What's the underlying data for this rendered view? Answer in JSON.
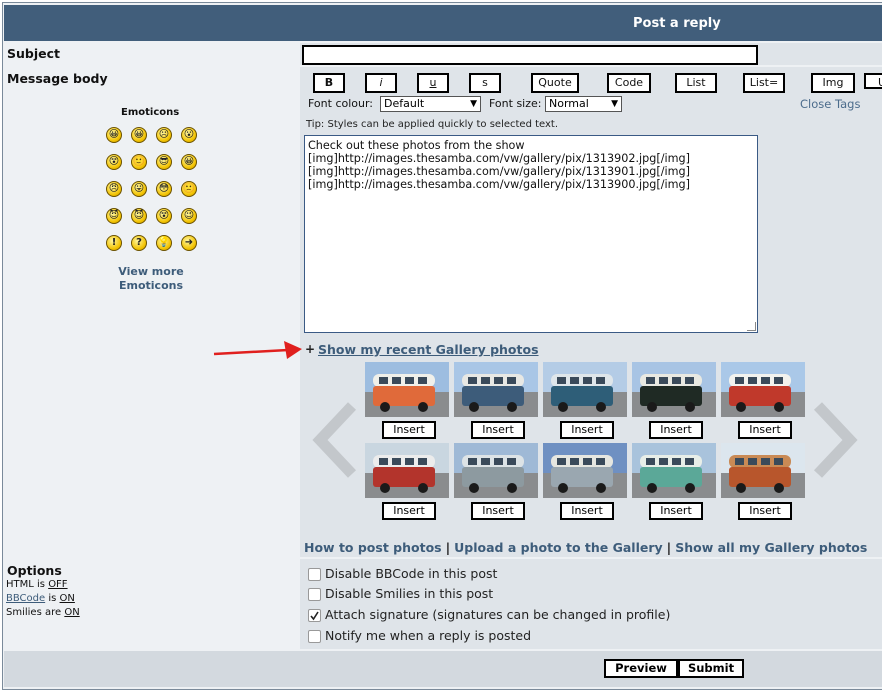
{
  "header": {
    "title": "Post a reply"
  },
  "subject": {
    "label": "Subject",
    "value": ""
  },
  "message": {
    "label": "Message body"
  },
  "emoticons": {
    "title": "Emoticons",
    "view_more_line1": "View more",
    "view_more_line2": "Emoticons",
    "rows": [
      [
        "😀",
        "😀",
        "☹",
        "😮"
      ],
      [
        "😵",
        "🙂",
        "😎",
        "😀"
      ],
      [
        "😠",
        "😛",
        "😳",
        "🙁"
      ],
      [
        "😈",
        "😈",
        "😵",
        "😉"
      ],
      [
        "!",
        "?",
        "💡",
        "➜"
      ]
    ]
  },
  "toolbar": {
    "b": "B",
    "i": "i",
    "u": "u",
    "s": "s",
    "quote": "Quote",
    "code": "Code",
    "list": "List",
    "list_eq": "List=",
    "img": "Img",
    "url": "U"
  },
  "font": {
    "colour_label": "Font colour:",
    "colour_value": "Default",
    "size_label": "Font size:",
    "size_value": "Normal",
    "close_tags": "Close Tags"
  },
  "tip": "Tip: Styles can be applied quickly to selected text.",
  "body_text": {
    "line1": "Check out these photos from the show",
    "line2": "[img]http://images.thesamba.com/vw/gallery/pix/1313902.jpg[/img]",
    "line3": "[img]http://images.thesamba.com/vw/gallery/pix/1313901.jpg[/img]",
    "line4": "[img]http://images.thesamba.com/vw/gallery/pix/1313900.jpg[/img]"
  },
  "gallery": {
    "toggle": "+",
    "show_recent": "Show my recent Gallery photos",
    "insert_label": "Insert",
    "thumbs_row1": [
      {
        "body": "#e06a3a",
        "top": "#f0f0ea",
        "sky": "#9dbde0"
      },
      {
        "body": "#3d5c7a",
        "top": "#e8e8e4",
        "sky": "#a9c6e6"
      },
      {
        "body": "#2e5e78",
        "top": "#dfe6ea",
        "sky": "#b4cce6"
      },
      {
        "body": "#1f2a24",
        "top": "#e9e9e2",
        "sky": "#a8c4e4"
      },
      {
        "body": "#c0392b",
        "top": "#f2f2ee",
        "sky": "#aac8e8"
      }
    ],
    "thumbs_row2": [
      {
        "body": "#b3342c",
        "top": "#ececec",
        "sky": "#c9d6e0"
      },
      {
        "body": "#8d9aa0",
        "top": "#dde3e6",
        "sky": "#9fb9d6"
      },
      {
        "body": "#9aa7b0",
        "top": "#e6e6e0",
        "sky": "#6f90c2"
      },
      {
        "body": "#5ba898",
        "top": "#e8eee8",
        "sky": "#a9c3dc"
      },
      {
        "body": "#b8562c",
        "top": "#c98a55",
        "sky": "#dce6ee"
      }
    ]
  },
  "links": {
    "how_to": "How to post photos",
    "upload": "Upload a photo to the Gallery",
    "show_all": "Show all my Gallery photos",
    "separator": "|"
  },
  "options": {
    "title": "Options",
    "html_prefix": "HTML is",
    "html_state": "OFF",
    "bbcode_label": "BBCode",
    "bbcode_mid": "is",
    "bbcode_state": "ON",
    "smilies_prefix": "Smilies are",
    "smilies_state": "ON",
    "disable_bbcode": "Disable BBCode in this post",
    "disable_smilies": "Disable Smilies in this post",
    "attach_sig": "Attach signature (signatures can be changed in profile)",
    "notify": "Notify me when a reply is posted",
    "attach_sig_checked": true
  },
  "actions": {
    "preview": "Preview",
    "submit": "Submit"
  },
  "colors": {
    "header_bg": "#415e7b",
    "link": "#3d5c7a",
    "arrow": "#e0201e"
  }
}
